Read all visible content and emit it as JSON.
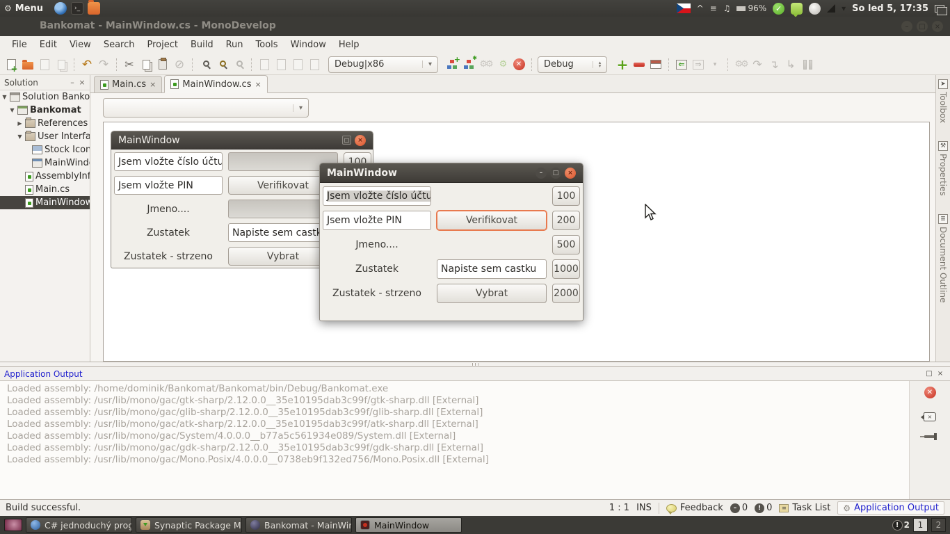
{
  "desktop": {
    "menu_label": "Menu",
    "clock": "So led  5, 17:35",
    "battery": "96%"
  },
  "ide": {
    "title": "Bankomat - MainWindow.cs - MonoDevelop"
  },
  "menubar": {
    "items": [
      "File",
      "Edit",
      "View",
      "Search",
      "Project",
      "Build",
      "Run",
      "Tools",
      "Window",
      "Help"
    ]
  },
  "toolbar": {
    "config_combo": "Debug|x86",
    "run_combo": "Debug"
  },
  "solution": {
    "header": "Solution",
    "items": [
      {
        "label": "Solution Bankomat"
      },
      {
        "label": "Bankomat"
      },
      {
        "label": "References"
      },
      {
        "label": "User Interface"
      },
      {
        "label": "Stock Icons"
      },
      {
        "label": "MainWindow"
      },
      {
        "label": "AssemblyInfo.cs"
      },
      {
        "label": "Main.cs"
      },
      {
        "label": "MainWindow.cs"
      }
    ]
  },
  "tabs": [
    {
      "label": "Main.cs"
    },
    {
      "label": "MainWindow.cs"
    }
  ],
  "side_tabs": [
    {
      "label": "Toolbox"
    },
    {
      "label": "Properties"
    },
    {
      "label": "Document Outline"
    }
  ],
  "back_window": {
    "title": "MainWindow",
    "account_entry": "Jsem vložte číslo účtu",
    "pin_entry": "Jsem vložte PIN",
    "verify_button": "Verifikovat",
    "name_label": "Jmeno....",
    "balance_label": "Zustatek",
    "amount_entry": "Napiste sem castku",
    "withdraw_label": "Zustatek - strzeno",
    "withdraw_button": "Vybrat",
    "amount_100": "100"
  },
  "front_window": {
    "title": "MainWindow",
    "account_entry": "Jsem vložte číslo účtu",
    "pin_entry": "Jsem vložte PIN",
    "verify_button": "Verifikovat",
    "name_label": "Jmeno....",
    "balance_label": "Zustatek",
    "amount_entry": "Napiste sem castku",
    "withdraw_label": "Zustatek - strzeno",
    "withdraw_button": "Vybrat",
    "amounts": [
      "100",
      "200",
      "500",
      "1000",
      "2000"
    ]
  },
  "output": {
    "header": "Application Output",
    "lines": [
      "Loaded assembly: /home/dominik/Bankomat/Bankomat/bin/Debug/Bankomat.exe",
      "Loaded assembly: /usr/lib/mono/gac/gtk-sharp/2.12.0.0__35e10195dab3c99f/gtk-sharp.dll [External]",
      "Loaded assembly: /usr/lib/mono/gac/glib-sharp/2.12.0.0__35e10195dab3c99f/glib-sharp.dll [External]",
      "Loaded assembly: /usr/lib/mono/gac/atk-sharp/2.12.0.0__35e10195dab3c99f/atk-sharp.dll [External]",
      "Loaded assembly: /usr/lib/mono/gac/System/4.0.0.0__b77a5c561934e089/System.dll [External]",
      "Loaded assembly: /usr/lib/mono/gac/gdk-sharp/2.12.0.0__35e10195dab3c99f/gdk-sharp.dll [External]",
      "Loaded assembly: /usr/lib/mono/gac/Mono.Posix/4.0.0.0__0738eb9f132ed756/Mono.Posix.dll [External]"
    ]
  },
  "statusbar": {
    "message": "Build successful.",
    "caret_pos": "1 : 1",
    "mode": "INS",
    "feedback": "Feedback",
    "error_count": "0",
    "warning_count": "0",
    "task_list": "Task List",
    "app_output": "Application Output"
  },
  "taskbar": {
    "tasks": [
      {
        "label": "C# jednoduchý prog..."
      },
      {
        "label": "Synaptic Package M..."
      },
      {
        "label": "Bankomat - MainWin..."
      },
      {
        "label": "MainWindow"
      }
    ],
    "alert_count": "2",
    "workspaces": [
      "1",
      "2"
    ]
  },
  "glyphs": {
    "gear": "⚙",
    "caret": "^",
    "music": "♫",
    "check": "✓",
    "minimize": "–",
    "maximize": "□",
    "close": "×",
    "dropdown": "▾",
    "tree_open": "▼",
    "tree_closed": "▶",
    "undo": "↶",
    "redo": "↷",
    "cut": "✂",
    "block": "⊘",
    "spin_up": "▴",
    "spin_down": "▾",
    "plus": "+",
    "dash": "–",
    "excl": "!",
    "step_over": "↷",
    "step_into": "↴",
    "step_out": "↳",
    "term": "›_",
    "vlist": "≡"
  },
  "colors": {
    "panel_dark": "#3B3A36",
    "toolbar_bg": "#F1EFEB",
    "accent_orange": "#E8794E",
    "output_text": "#A9A49D",
    "link_blue": "#2323CE",
    "stop_red": "#C62F1F"
  }
}
